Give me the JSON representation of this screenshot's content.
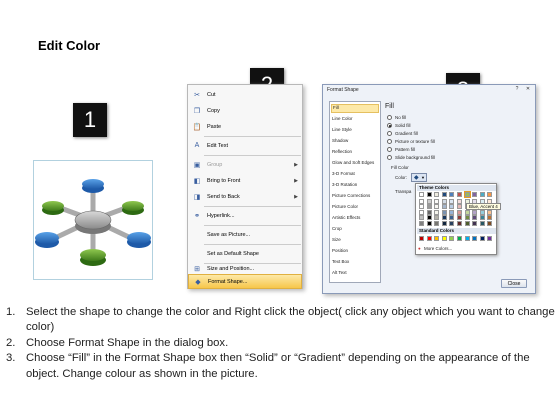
{
  "title": "Edit Color",
  "steps_badges": [
    "1",
    "2",
    "3"
  ],
  "context_menu": {
    "items": [
      {
        "label": "Cut",
        "icon": "scissors-icon",
        "glyph": "✂"
      },
      {
        "label": "Copy",
        "icon": "copy-icon",
        "glyph": "❐"
      },
      {
        "label": "Paste",
        "icon": "paste-icon",
        "glyph": "📋"
      },
      {
        "label": "Edit Text",
        "icon": "edit-text-icon",
        "glyph": "A"
      },
      {
        "label": "Group",
        "icon": "group-icon",
        "glyph": "▣",
        "disabled": true,
        "submenu": true
      },
      {
        "label": "Bring to Front",
        "icon": "bring-front-icon",
        "glyph": "◧",
        "submenu": true
      },
      {
        "label": "Send to Back",
        "icon": "send-back-icon",
        "glyph": "◨",
        "submenu": true
      },
      {
        "label": "Hyperlink...",
        "icon": "hyperlink-icon",
        "glyph": "⚭"
      },
      {
        "label": "Save as Picture...",
        "icon": "",
        "glyph": ""
      },
      {
        "label": "Set as Default Shape",
        "icon": "",
        "glyph": ""
      },
      {
        "label": "Size and Position...",
        "icon": "size-position-icon",
        "glyph": "⊞"
      },
      {
        "label": "Format Shape...",
        "icon": "format-shape-icon",
        "glyph": "◆",
        "highlighted": true
      }
    ]
  },
  "format_dialog": {
    "title": "Format Shape",
    "help_label": "?",
    "close_x": "✕",
    "categories": [
      "Fill",
      "Line Color",
      "Line Style",
      "Shadow",
      "Reflection",
      "Glow and Soft Edges",
      "3-D Format",
      "3-D Rotation",
      "Picture Corrections",
      "Picture Color",
      "Artistic Effects",
      "Crop",
      "Size",
      "Position",
      "Text Box",
      "Alt Text"
    ],
    "fill_heading": "Fill",
    "fill_options": [
      {
        "label": "No fill",
        "selected": false
      },
      {
        "label": "Solid fill",
        "selected": true
      },
      {
        "label": "Gradient fill",
        "selected": false
      },
      {
        "label": "Picture or texture fill",
        "selected": false
      },
      {
        "label": "Pattern fill",
        "selected": false
      },
      {
        "label": "Slide background fill",
        "selected": false
      }
    ],
    "fill_color_label": "Fill Color",
    "color_label": "Color:",
    "transparency_label": "Transpa",
    "theme_colors_label": "Theme Colors",
    "standard_colors_label": "Standard Colors",
    "more_colors_label": "More Colors...",
    "tooltip": "Blue, Accent 4",
    "close_button": "Close",
    "theme_row": [
      "#ffffff",
      "#000000",
      "#eeece1",
      "#1f497d",
      "#4f81bd",
      "#c0504d",
      "#9bbb59",
      "#8064a2",
      "#4bacc6",
      "#f79646"
    ],
    "standard_row": [
      "#c00000",
      "#ff0000",
      "#ffc000",
      "#ffff00",
      "#92d050",
      "#00b050",
      "#00b0f0",
      "#0070c0",
      "#002060",
      "#7030a0"
    ]
  },
  "instructions": [
    {
      "num": "1.",
      "text": "Select the shape to change the color and Right click the object( click any object which you want to change color)"
    },
    {
      "num": "2.",
      "text": "Choose Format Shape in the dialog box."
    },
    {
      "num": "3.",
      "text": "Choose “Fill” in the Format Shape box then “Solid” or “Gradient” depending on the appearance of the object. Change colour as shown in the picture."
    }
  ]
}
